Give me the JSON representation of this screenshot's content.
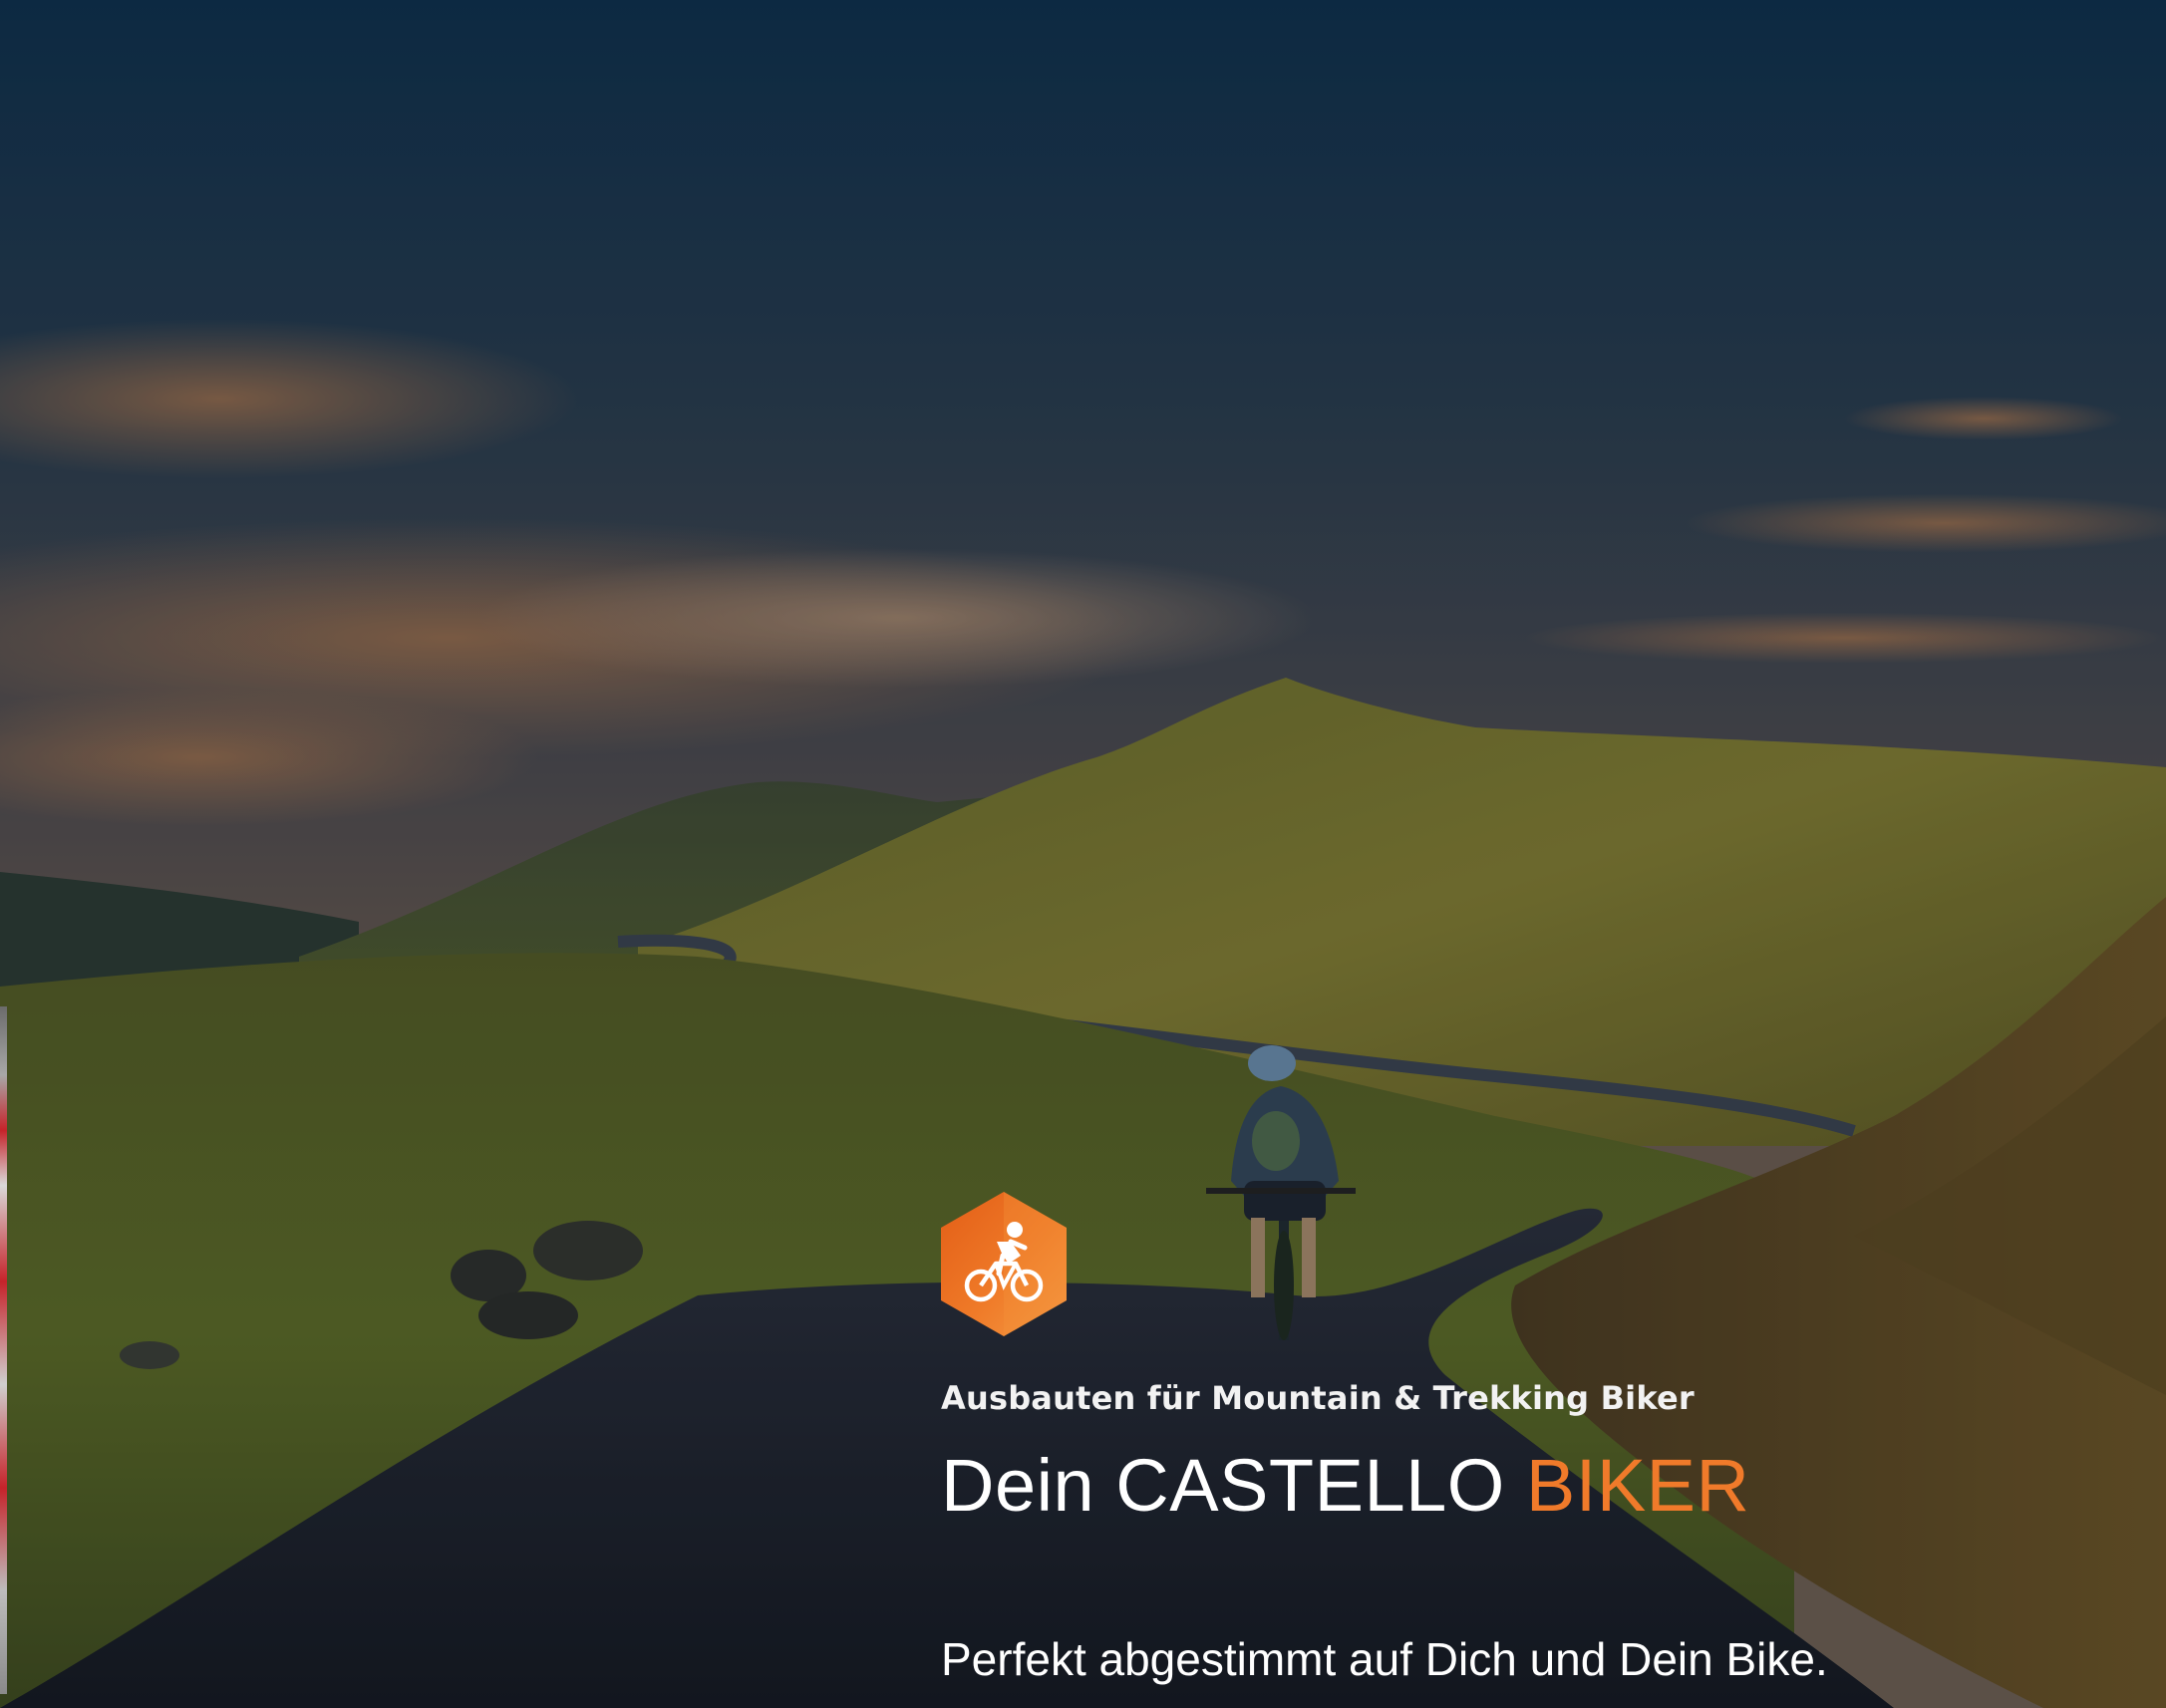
{
  "hero": {
    "background": "mountain-road-cyclist-photo",
    "badge_icon": "cyclist-icon",
    "subtitle": "Ausbauten für Mountain & Trekking Biker",
    "title_main": "Dein CASTELLO ",
    "title_accent": "BIKER",
    "tagline": "Perfekt abgestimmt auf Dich und Dein Bike."
  },
  "colors": {
    "accent": "#f07a2a",
    "badge_dark": "#e0621a",
    "text": "#ffffff"
  }
}
